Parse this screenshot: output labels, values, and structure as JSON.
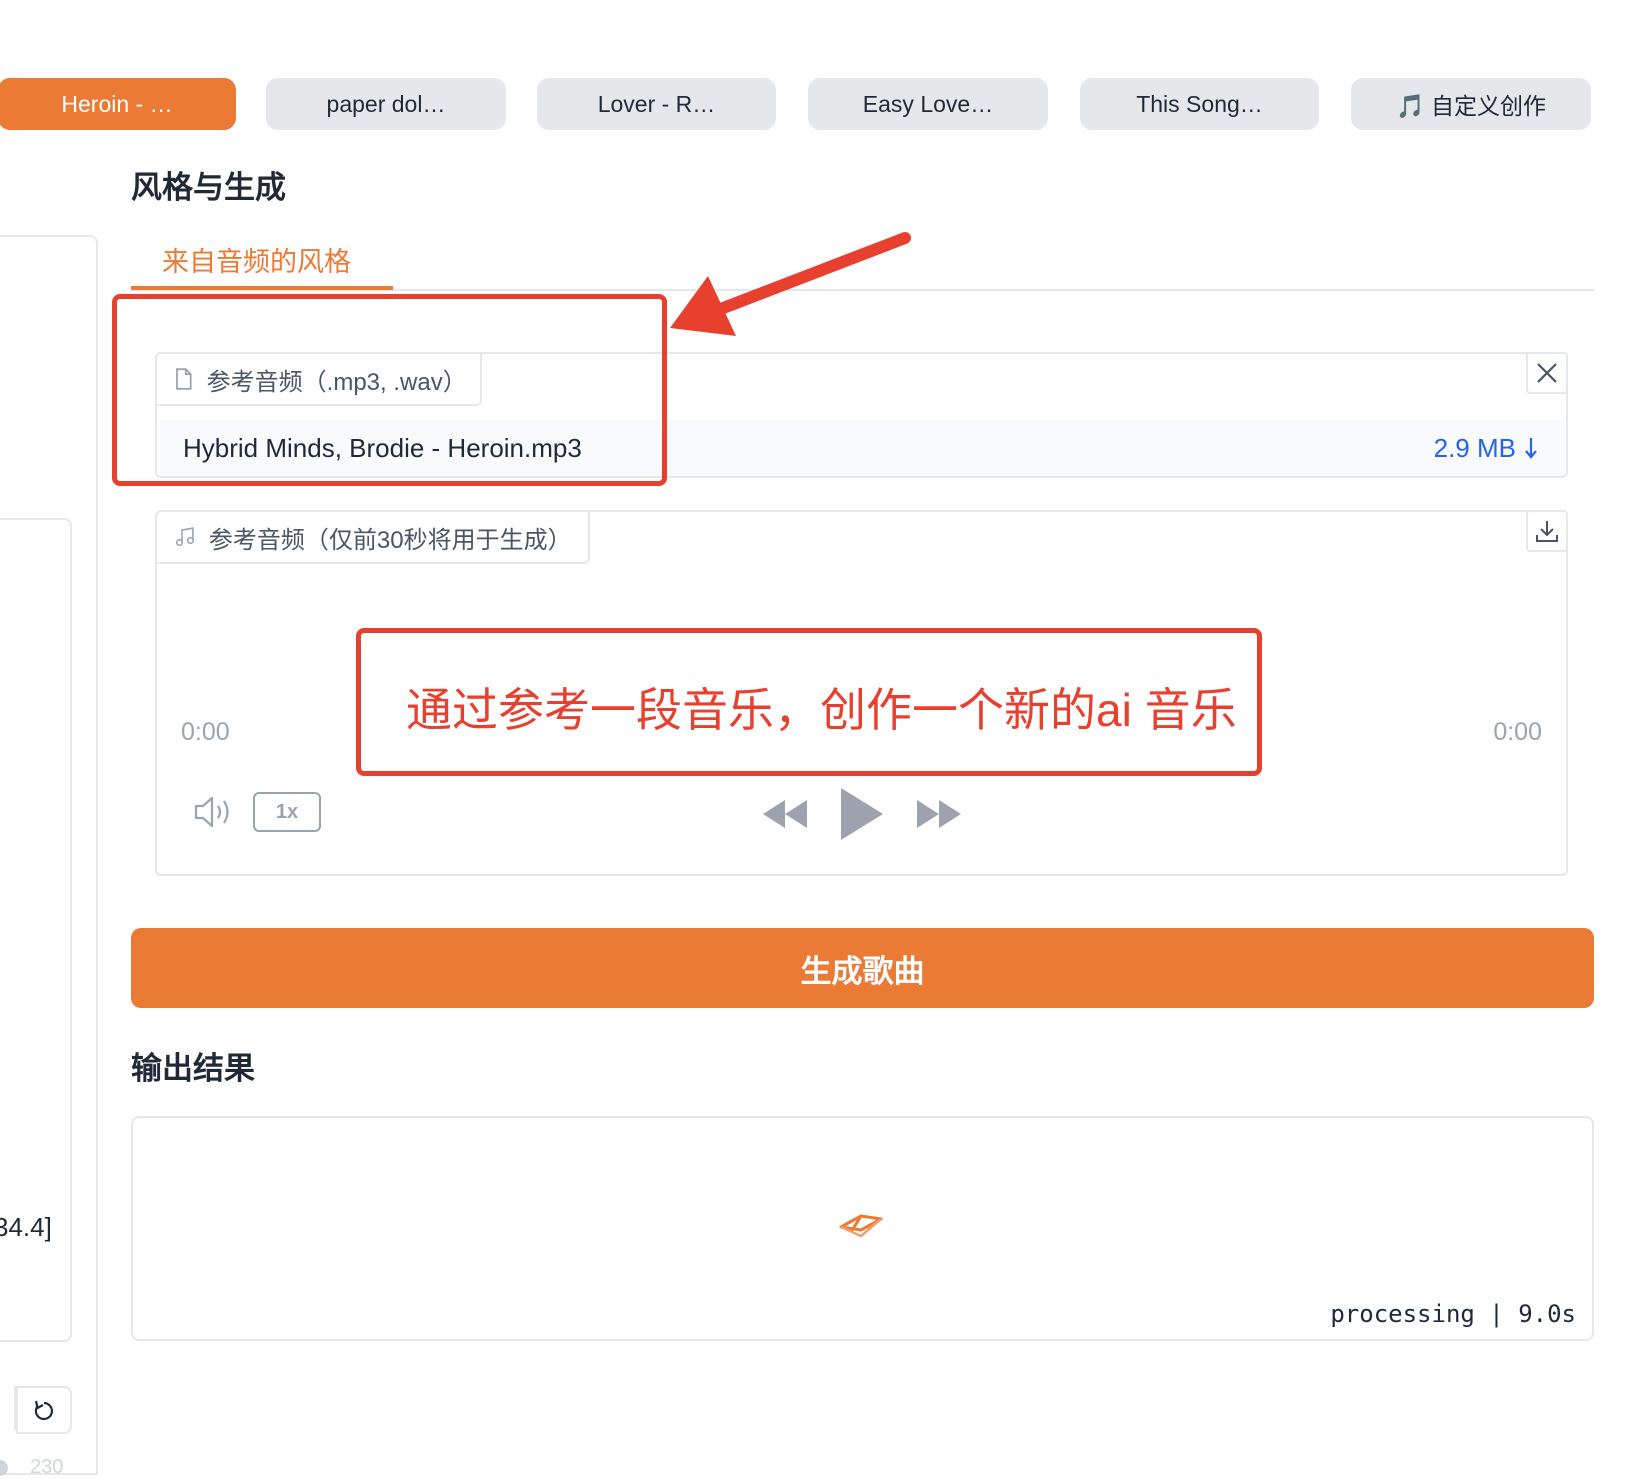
{
  "presets": [
    {
      "label": "Heroin - …",
      "active": true
    },
    {
      "label": "paper dol…",
      "active": false
    },
    {
      "label": "Lover - R…",
      "active": false
    },
    {
      "label": "Easy Love…",
      "active": false
    },
    {
      "label": "This Song…",
      "active": false
    },
    {
      "label": "🎵 自定义创作",
      "active": false
    }
  ],
  "style_section": {
    "title": "风格与生成",
    "tab": "来自音频的风格"
  },
  "upload": {
    "label": "参考音频（.mp3, .wav）",
    "file_name": "Hybrid Minds, Brodie - Heroin.mp3",
    "file_size": "2.9 MB"
  },
  "player": {
    "label": "参考音频（仅前30秒将用于生成）",
    "current_time": "0:00",
    "duration": "0:00",
    "speed": "1x"
  },
  "annotation": {
    "text": "通过参考一段音乐，创作一个新的ai 音乐"
  },
  "generate_button": "生成歌曲",
  "output": {
    "title": "输出结果",
    "status": "processing | 9.0s"
  },
  "left_column": {
    "partial_value": "34.4]",
    "partial_number": "230"
  },
  "colors": {
    "accent": "#ea7a34",
    "annotation_red": "#e8402e",
    "link_blue": "#2563eb",
    "button_gray": "#e5e7eb"
  }
}
